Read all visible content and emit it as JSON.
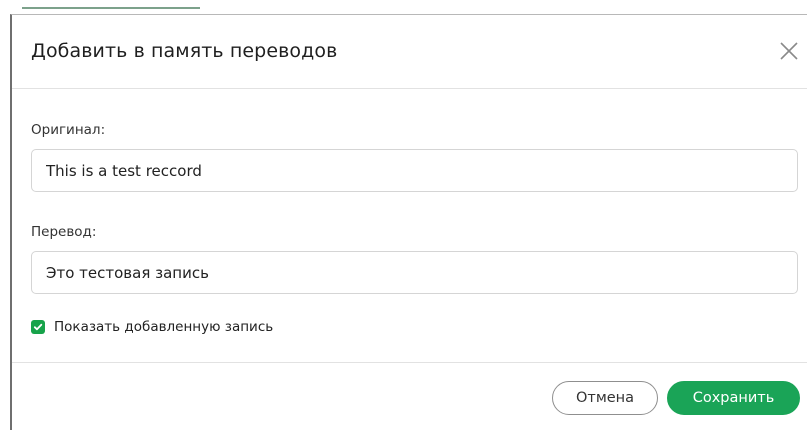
{
  "dialog": {
    "title": "Добавить в память переводов",
    "close_icon": "close-icon"
  },
  "fields": {
    "original": {
      "label": "Оригинал:",
      "value": "This is a test reccord"
    },
    "translation": {
      "label": "Перевод:",
      "value": "Это тестовая запись"
    }
  },
  "show_added": {
    "label": "Показать добавленную запись",
    "checked": true,
    "icon": "checkmark-icon"
  },
  "footer": {
    "cancel_label": "Отмена",
    "save_label": "Сохранить"
  },
  "colors": {
    "accent": "#1aa457",
    "checkbox": "#17a34a"
  }
}
